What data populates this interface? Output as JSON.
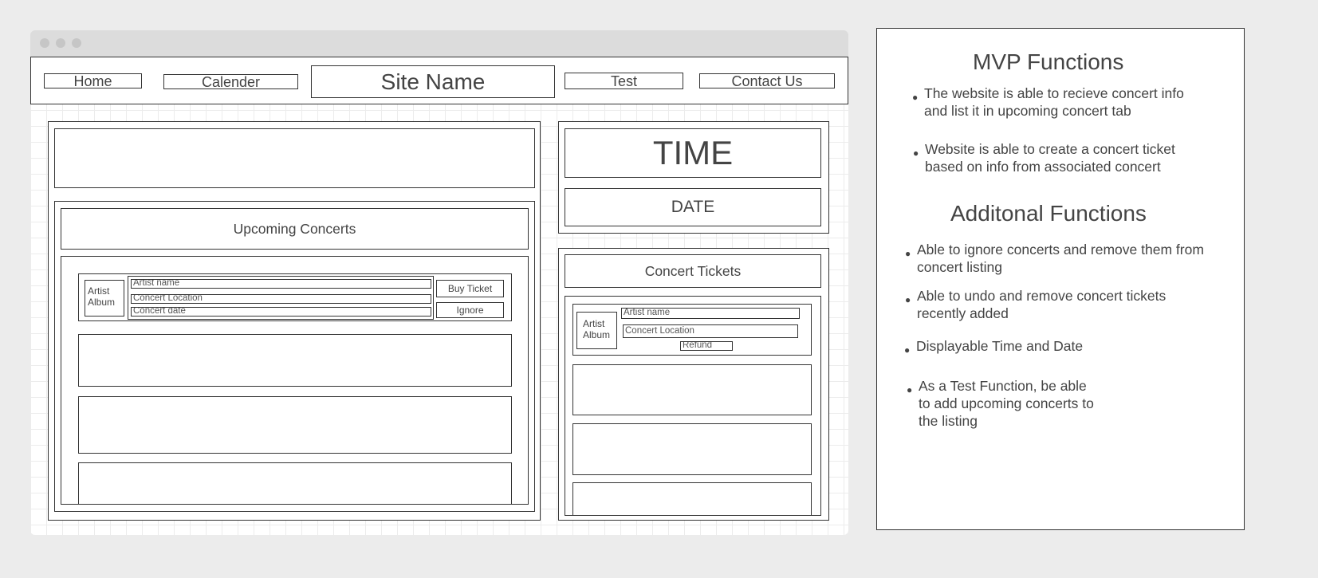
{
  "nav": {
    "home": "Home",
    "calender": "Calender",
    "site_name": "Site Name",
    "test": "Test",
    "contact": "Contact Us"
  },
  "upcoming": {
    "title": "Upcoming Concerts",
    "card": {
      "album": "Artist\nAlbum",
      "artist_name": "Artist name",
      "location": "Concert Location",
      "date": "Concert date",
      "buy_label": "Buy Ticket",
      "ignore_label": "Ignore"
    }
  },
  "clock": {
    "time": "TIME",
    "date": "DATE"
  },
  "tickets": {
    "title": "Concert Tickets",
    "card": {
      "album": "Artist\nAlbum",
      "artist_name": "Artist name",
      "location": "Concert Location",
      "refund_label": "Refund"
    }
  },
  "notes": {
    "mvp_heading": "MVP Functions",
    "mvp": [
      "The website is able to recieve concert info\nand list it in upcoming concert tab",
      "Website is able to create a concert ticket\nbased on info from associated concert"
    ],
    "additional_heading": "Additonal Functions",
    "additional": [
      "Able to ignore concerts and remove them from\nconcert listing",
      "Able to undo and remove concert tickets\nrecently added",
      "Displayable Time and Date",
      "As a Test Function, be able\nto add upcoming concerts to\nthe listing"
    ],
    "bullet_glyph": "●"
  }
}
